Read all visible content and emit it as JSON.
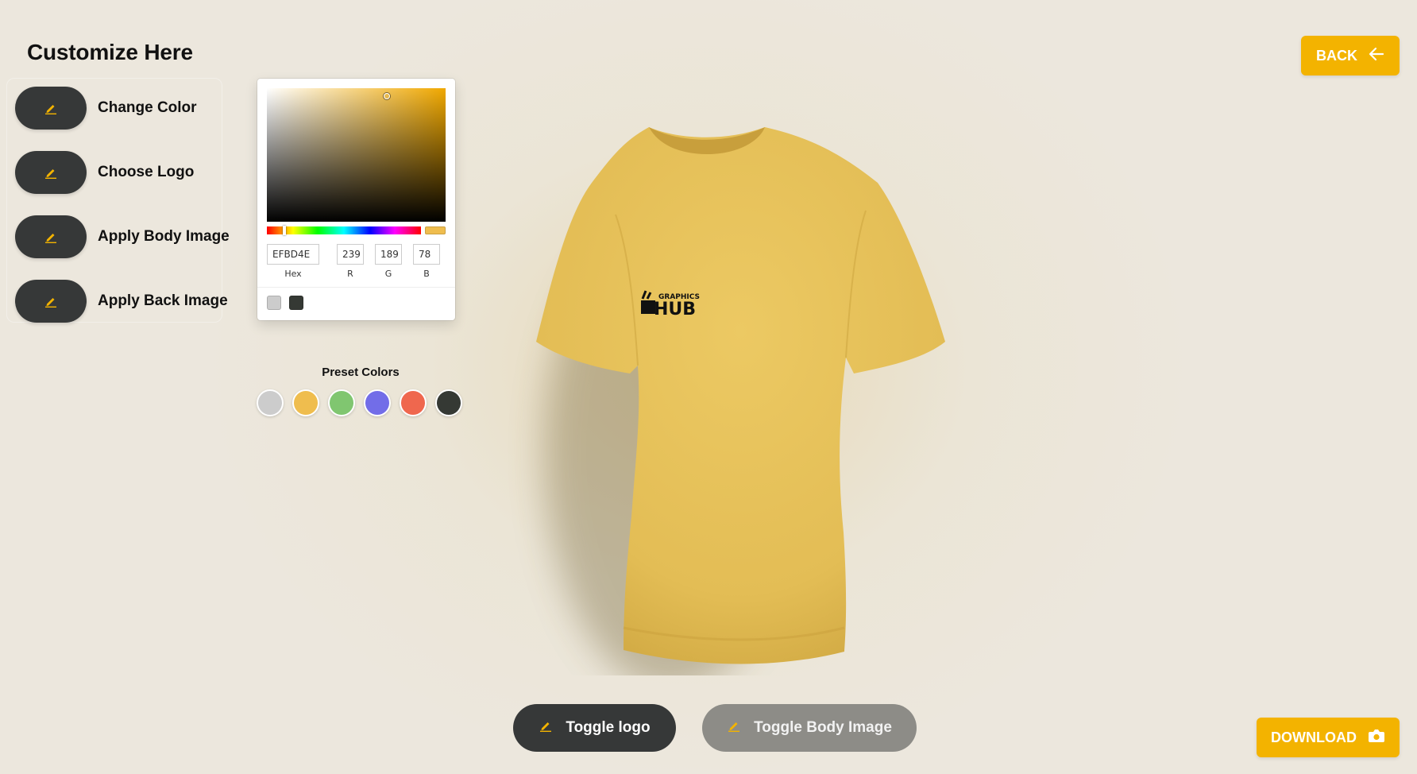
{
  "header": {
    "title": "Customize Here"
  },
  "menu": {
    "items": [
      {
        "label": "Change Color",
        "icon": "pencil-icon"
      },
      {
        "label": "Choose Logo",
        "icon": "pencil-icon"
      },
      {
        "label": "Apply Body Image",
        "icon": "pencil-icon"
      },
      {
        "label": "Apply Back Image",
        "icon": "pencil-icon"
      }
    ]
  },
  "color_picker": {
    "hex": "EFBD4E",
    "r": "239",
    "g": "189",
    "b": "78",
    "hex_label": "Hex",
    "r_label": "R",
    "g_label": "G",
    "b_label": "B",
    "current_color": "#efbd4e",
    "recent_colors": [
      "#cccccc",
      "#353934"
    ]
  },
  "presets": {
    "title": "Preset Colors",
    "colors": [
      "#cccccc",
      "#efbd4e",
      "#80c670",
      "#726de8",
      "#ef674e",
      "#353934"
    ]
  },
  "logo": {
    "line1": "GRAPHICS",
    "line2": "HUB"
  },
  "buttons": {
    "back": "BACK",
    "download": "DOWNLOAD",
    "toggle_logo": "Toggle logo",
    "toggle_body_image": "Toggle Body Image"
  },
  "colors": {
    "accent": "#f3b300",
    "dark": "#363838",
    "shirt": "#e3bf57"
  }
}
